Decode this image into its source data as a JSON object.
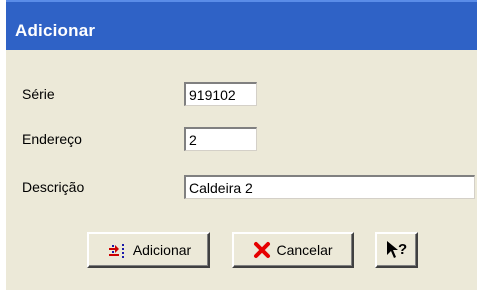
{
  "window": {
    "title": "Adicionar"
  },
  "form": {
    "serie": {
      "label": "Série",
      "value": "919102"
    },
    "endereco": {
      "label": "Endereço",
      "value": "2"
    },
    "descricao": {
      "label": "Descrição",
      "value": "Caldeira 2"
    }
  },
  "buttons": {
    "add_label": "Adicionar",
    "cancel_label": "Cancelar",
    "add_icon": "add-arrow-icon",
    "cancel_icon": "red-x-icon",
    "help_icon": "help-pointer-icon"
  },
  "colors": {
    "title_bar": "#2f62c6",
    "dialog_bg": "#ece9d8",
    "cancel_x": "#e60000",
    "add_arrow": "#cc0000"
  }
}
